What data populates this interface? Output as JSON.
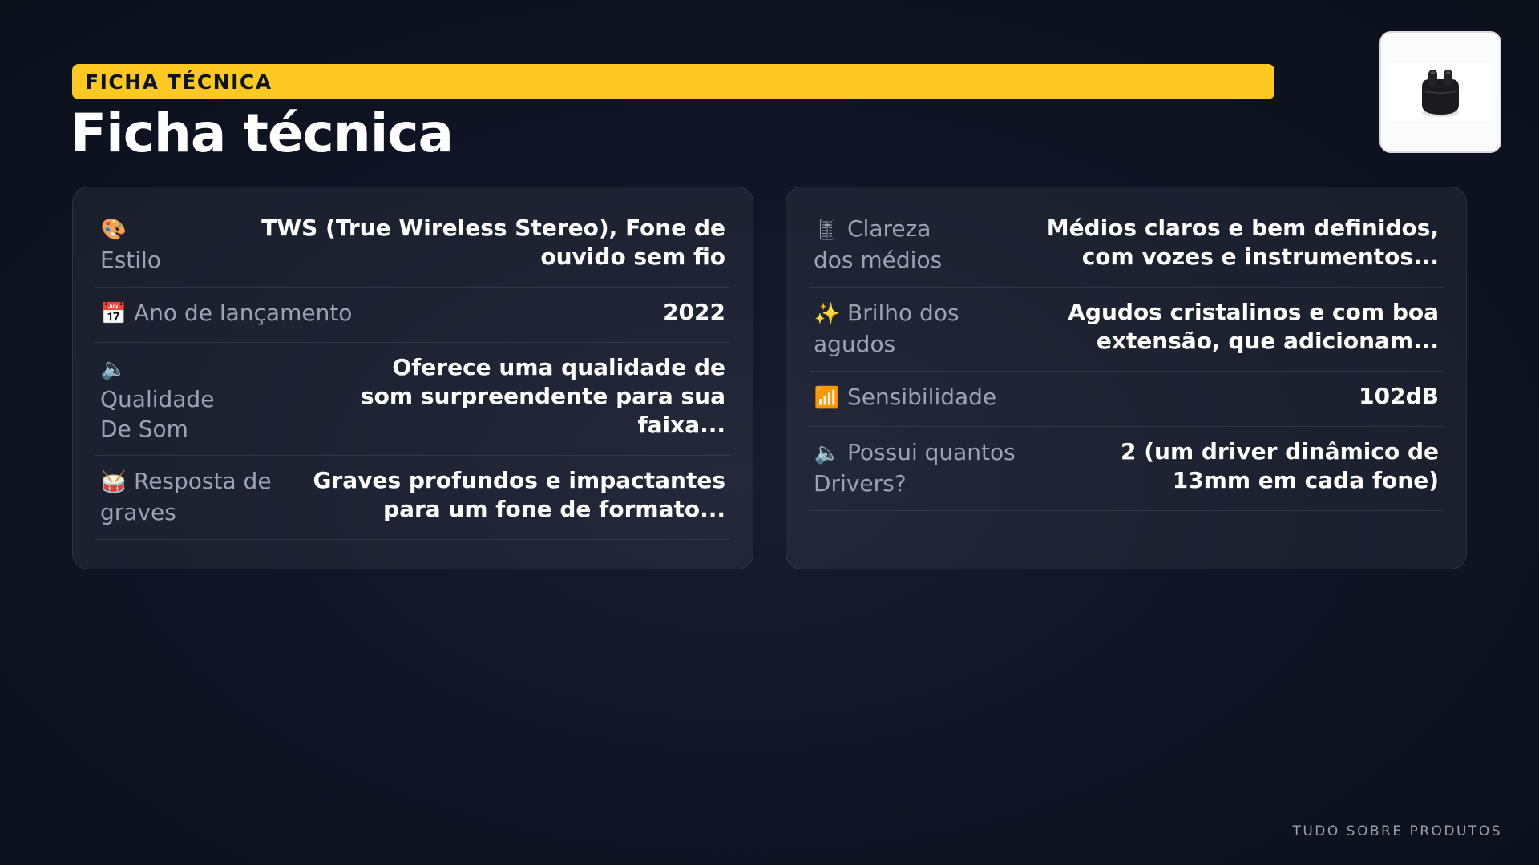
{
  "header": {
    "tag": "FICHA TÉCNICA",
    "title": "Ficha técnica"
  },
  "product_image": {
    "alt": "earbuds-case"
  },
  "left_specs": [
    {
      "icon": "🎨",
      "icon_name": "palette-icon",
      "label": "Estilo",
      "value": "TWS (True Wireless Stereo), Fone de ouvido sem fio"
    },
    {
      "icon": "📅",
      "icon_name": "calendar-icon",
      "label": "Ano de lançamento",
      "value": "2022"
    },
    {
      "icon": "🔈",
      "icon_name": "speaker-icon",
      "label": "Qualidade De Som",
      "value": "Oferece uma qualidade de som surpreendente para sua faixa..."
    },
    {
      "icon": "🥁",
      "icon_name": "drum-icon",
      "label": "Resposta de graves",
      "value": "Graves profundos e impactantes para um fone de formato..."
    }
  ],
  "right_specs": [
    {
      "icon": "🎚",
      "icon_name": "level-slider-icon",
      "label": "Clareza dos médios",
      "value": "Médios claros e bem definidos, com vozes e instrumentos..."
    },
    {
      "icon": "✨",
      "icon_name": "sparkles-icon",
      "label": "Brilho dos agudos",
      "value": "Agudos cristalinos e com boa extensão, que adicionam..."
    },
    {
      "icon": "📶",
      "icon_name": "signal-bars-icon",
      "label": "Sensibilidade",
      "value": "102dB"
    },
    {
      "icon": "🔈",
      "icon_name": "speaker-icon",
      "label": "Possui quantos Drivers?",
      "value": "2 (um driver dinâmico de 13mm em cada fone)"
    }
  ],
  "footer": {
    "brand": "TUDO SOBRE PRODUTOS"
  },
  "colors": {
    "accent": "#fcc821",
    "background": "#0f1422",
    "card": "#1d2230",
    "label": "#9ea3b3"
  }
}
